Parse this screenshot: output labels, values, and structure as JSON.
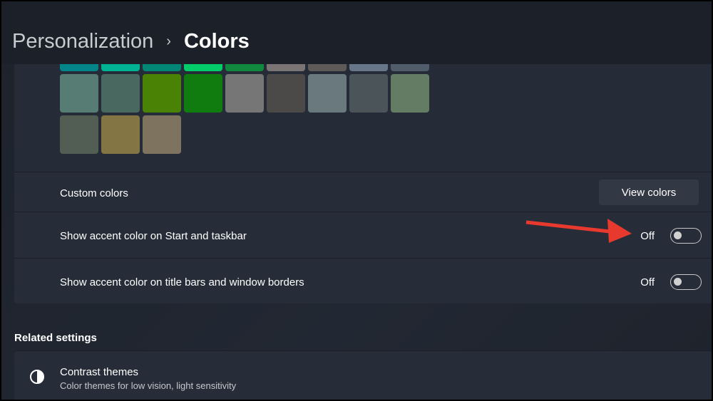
{
  "breadcrumb": {
    "parent": "Personalization",
    "separator": "›",
    "current": "Colors"
  },
  "swatches": {
    "row0": [
      "#04858a",
      "#00b294",
      "#018574",
      "#00cc6a",
      "#10893e",
      "#7a7574",
      "#5d5a58",
      "#68768a",
      "#515c6b"
    ],
    "row1": [
      "#567c73",
      "#486860",
      "#498205",
      "#107c10",
      "#767676",
      "#4c4a48",
      "#69797e",
      "#4a5459",
      "#647c64"
    ],
    "row2": [
      "#525e54",
      "#847545",
      "#7e735f"
    ]
  },
  "custom_colors": {
    "label": "Custom colors",
    "button": "View colors"
  },
  "accent_start": {
    "label": "Show accent color on Start and taskbar",
    "state": "Off"
  },
  "accent_title": {
    "label": "Show accent color on title bars and window borders",
    "state": "Off"
  },
  "related": {
    "heading": "Related settings",
    "contrast_title": "Contrast themes",
    "contrast_sub": "Color themes for low vision, light sensitivity"
  },
  "annotation_color": "#e8392e"
}
